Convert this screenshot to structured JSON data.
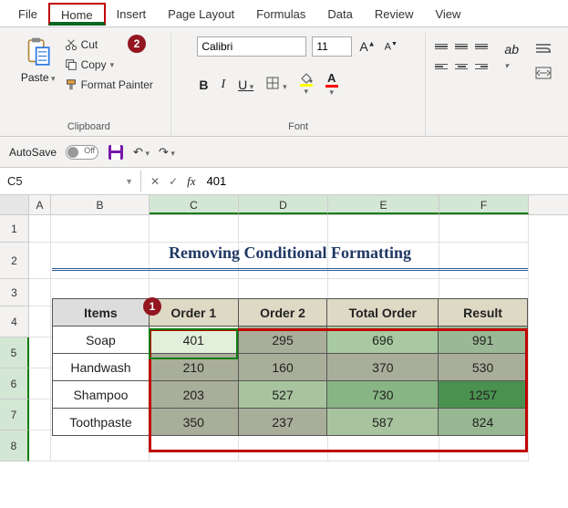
{
  "tabs": {
    "file": "File",
    "home": "Home",
    "insert": "Insert",
    "pagelayout": "Page Layout",
    "formulas": "Formulas",
    "data": "Data",
    "review": "Review",
    "view": "View"
  },
  "ribbon": {
    "clipboard": {
      "paste": "Paste",
      "cut": "Cut",
      "copy": "Copy",
      "format_painter": "Format Painter",
      "group_label": "Clipboard"
    },
    "font": {
      "name": "Calibri",
      "size": "11",
      "bold": "B",
      "italic": "I",
      "underline": "U",
      "font_color_letter": "A",
      "fill_letter": "A",
      "group_label": "Font"
    },
    "alignment": {
      "group_label": ""
    }
  },
  "autosave": {
    "label": "AutoSave",
    "state": "Off"
  },
  "cellref": {
    "name": "C5",
    "formula_value": "401"
  },
  "columns": [
    "A",
    "B",
    "C",
    "D",
    "E",
    "F"
  ],
  "rows": [
    "1",
    "2",
    "3",
    "4",
    "5",
    "6",
    "7",
    "8"
  ],
  "title": "Removing Conditional Formatting",
  "badges": {
    "b1": "1",
    "b2": "2"
  },
  "table": {
    "headers": {
      "items": "Items",
      "o1": "Order 1",
      "o2": "Order 2",
      "total": "Total Order",
      "result": "Result"
    },
    "data": [
      {
        "item": "Soap",
        "o1": "401",
        "o2": "295",
        "total": "696",
        "result": "991"
      },
      {
        "item": "Handwash",
        "o1": "210",
        "o2": "160",
        "total": "370",
        "result": "530"
      },
      {
        "item": "Shampoo",
        "o1": "203",
        "o2": "527",
        "total": "730",
        "result": "1257"
      },
      {
        "item": "Toothpaste",
        "o1": "350",
        "o2": "237",
        "total": "587",
        "result": "824"
      }
    ]
  },
  "cell_colors": {
    "r1": {
      "o1": "#e2efda",
      "o2": "#a9ae9a",
      "total": "#a8c9a1",
      "result": "#9bb896"
    },
    "r2": {
      "o1": "#a9ae9a",
      "o2": "#a9ae9a",
      "total": "#a9ae9a",
      "result": "#a9ae9a"
    },
    "r3": {
      "o1": "#a9ae9a",
      "o2": "#a8c49e",
      "total": "#88b584",
      "result": "#4a9150"
    },
    "r4": {
      "o1": "#a9ae9a",
      "o2": "#a9ae9a",
      "total": "#a8c49e",
      "result": "#97b792"
    }
  }
}
